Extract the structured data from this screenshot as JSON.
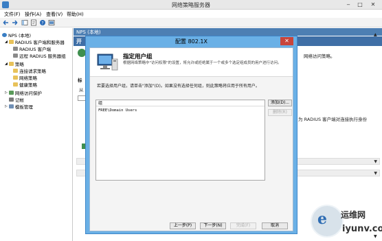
{
  "window": {
    "title": "网络策略服务器"
  },
  "menu": {
    "file": "文件(F)",
    "action": "操作(A)",
    "view": "查看(V)",
    "help": "帮助(H)"
  },
  "tree": {
    "root": "NPS (本地)",
    "radius_group": "RADIUS 客户端和服务器",
    "radius_clients": "RADIUS 客户端",
    "remote_radius": "远程 RADIUS 服务器组",
    "policies": "策略",
    "connection_request": "连接请求策略",
    "network_policies": "网络策略",
    "health_policies": "健康策略",
    "nap": "网络访问保护",
    "accounting": "记帐",
    "templates": "模板管理"
  },
  "right": {
    "header": "NPS (本地)",
    "band": "开",
    "text_top": "网络访问策略。",
    "text_mid": "为 RADIUS 客户端对连接执行身份",
    "label_letter1": "标",
    "label_letter2": "从"
  },
  "dialog": {
    "title": "配置 802.1X",
    "close": "✕",
    "heading": "指定用户组",
    "description": "根据网络策略中\"访问权限\"的设置，将允许或拒绝属于一个或多个选定组成员的用户进行访问。",
    "instruction": "若要选择用户组，请单击\"添加\"(D)。如果没有选择任何组，则此策略将应用于所有用户。",
    "group_header": "组",
    "group_value": "FREE\\Domain Users",
    "add_button": "添加(D)...",
    "remove_button": "删除(R)",
    "back_button": "上一步(P)",
    "next_button": "下一步(N)",
    "finish_button": "完成(F)",
    "cancel_button": "取消"
  },
  "watermark": {
    "cn": "运维网",
    "url": "iyunv.com"
  }
}
